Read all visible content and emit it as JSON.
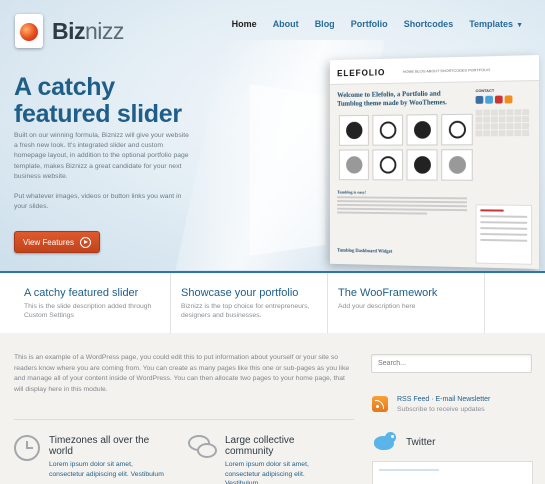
{
  "brand": {
    "name_bold": "Biz",
    "name_light": "nizz"
  },
  "nav": {
    "items": [
      {
        "label": "Home",
        "active": true
      },
      {
        "label": "About"
      },
      {
        "label": "Blog"
      },
      {
        "label": "Portfolio"
      },
      {
        "label": "Shortcodes"
      },
      {
        "label": "Templates",
        "has_dropdown": true
      }
    ]
  },
  "hero": {
    "title": "A catchy featured slider",
    "paragraph1": "Built on our winning formula, Biznizz will give your website a fresh new look. It's integrated slider and custom homepage layout, in addition to the optional portfolio page template, makes Biznizz a great candidate for your next business website.",
    "paragraph2": "Put whatever images, videos or button links you want in your slides.",
    "cta_label": "View Features",
    "screenshot": {
      "brand": "ELEFOLIO",
      "nav_text": "HOME  BLOG  ABOUT  SHORTCODES  PORTFOLIO",
      "nav_active": "BLOG",
      "welcome": "Welcome to Elefolio, a Portfolio and Tumblog theme made by WooThemes.",
      "post_title": "Tumblog is easy!",
      "dashboard_title": "Tumblog Dashboard Widget",
      "side_heading": "CONTACT"
    }
  },
  "features": [
    {
      "title": "A catchy featured slider",
      "desc": "This is the slide description added through Custom Settings"
    },
    {
      "title": "Showcase your portfolio",
      "desc": "Biznizz is the top choice for entrepreneurs, designers and businesses."
    },
    {
      "title": "The WooFramework",
      "desc": "Add your description here"
    }
  ],
  "content": {
    "intro": "This is an example of a WordPress page, you could edit this to put information about yourself or your site so readers know where you are coming from. You can create as many pages like this one or sub-pages as you like and manage all of your content inside of WordPress. You can then allocate two pages to your home page, that will display here in this module.",
    "blocks": [
      {
        "title": "Timezones all over the world",
        "desc": "Lorem ipsum dolor sit amet, consectetur adipiscing elit. Vestibulum",
        "icon": "clock-icon"
      },
      {
        "title": "Large collective community",
        "desc": "Lorem ipsum dolor sit amet, consectetur adipiscing elit. Vestibulum",
        "icon": "chat-bubbles-icon"
      }
    ]
  },
  "sidebar": {
    "search_placeholder": "Search...",
    "rss_title": "RSS Feed · E-mail Newsletter",
    "rss_sub": "Subscribe to receive updates",
    "twitter_title": "Twitter"
  },
  "colors": {
    "accent": "#1e5e88",
    "cta": "#d14e24",
    "rss": "#f18d20",
    "twitter": "#5ab4e8"
  }
}
